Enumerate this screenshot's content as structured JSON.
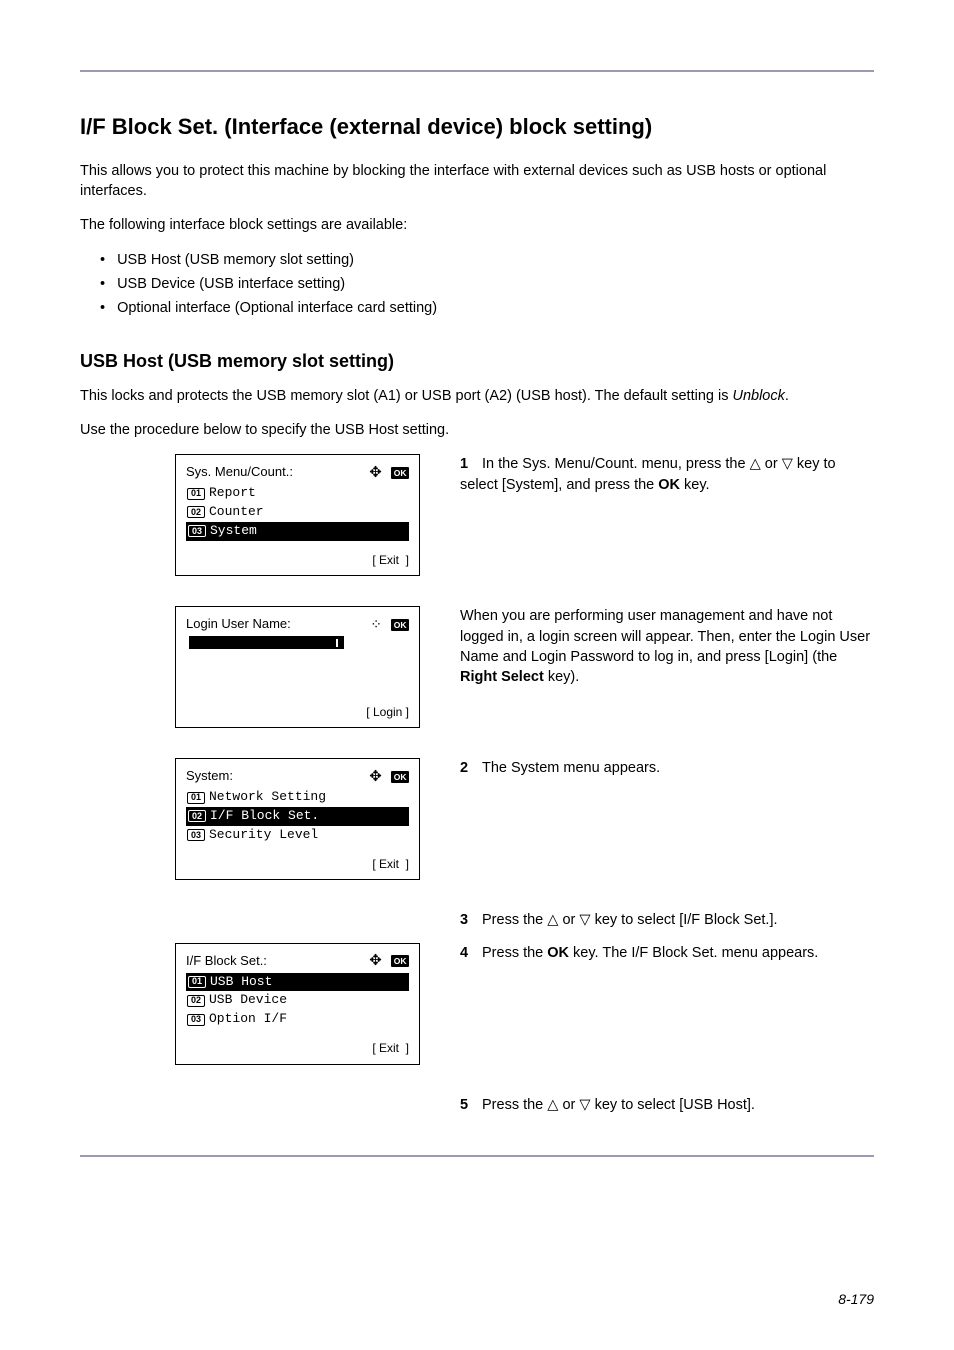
{
  "section_title": "I/F Block Set. (Interface (external device) block setting)",
  "intro": "This allows you to protect this machine by blocking the interface with external devices such as USB hosts or optional interfaces.",
  "intro2": "The following interface block settings are available:",
  "bullets": [
    "USB Host (USB memory slot setting)",
    "USB Device (USB interface setting)",
    "Optional interface (Optional interface card setting)"
  ],
  "sub_title": "USB Host (USB memory slot setting)",
  "sub_intro_a": "This locks and protects the USB memory slot (A1) or USB port (A2) (USB host). The default setting is ",
  "sub_intro_b": "Unblock",
  "sub_intro_c": ".",
  "sub_intro2": "Use the procedure below to specify the USB Host setting.",
  "steps": {
    "s1": {
      "num": "1",
      "text_a": "In the Sys. Menu/Count. menu, press the ",
      "text_b": " or ",
      "text_c": " key to select [System], and press the ",
      "text_d": "OK",
      "text_e": " key."
    },
    "s2": {
      "text_a": "When you are performing user management and have not logged in, a login screen will appear. Then, enter the Login User Name and Login Password to log in, and press [Login] (the ",
      "text_b": "Right Select",
      "text_c": " key)."
    },
    "s3": {
      "num": "2",
      "text": "The System menu appears."
    },
    "s4": {
      "num": "3",
      "text_a": "Press the ",
      "text_b": " or ",
      "text_c": " key to select [I/F Block Set.]."
    },
    "s5": {
      "num": "4",
      "text_a": "Press the ",
      "text_b": "OK",
      "text_c": " key. The I/F Block Set. menu appears."
    },
    "s6": {
      "num": "5",
      "text_a": "Press the ",
      "text_b": " or ",
      "text_c": " key to select [USB Host]."
    }
  },
  "lcd1": {
    "title": "Sys. Menu/Count.:",
    "ok": "OK",
    "l1": {
      "n": "01",
      "t": "Report"
    },
    "l2": {
      "n": "02",
      "t": "Counter"
    },
    "l3": {
      "n": "03",
      "t": "System"
    },
    "soft": "[ Exit  ]"
  },
  "lcd2": {
    "title": "Login User Name:",
    "ok": "OK",
    "soft_l": "",
    "soft_r": "[ Login ]"
  },
  "lcd3": {
    "title": "System:",
    "ok": "OK",
    "l1": {
      "n": "01",
      "t": "Network Setting"
    },
    "l2": {
      "n": "02",
      "t": "I/F Block Set."
    },
    "l3": {
      "n": "03",
      "t": "Security Level"
    },
    "soft": "[ Exit  ]"
  },
  "lcd4": {
    "title": "I/F Block Set.:",
    "ok": "OK",
    "l1": {
      "n": "01",
      "t": "USB Host"
    },
    "l2": {
      "n": "02",
      "t": "USB Device"
    },
    "l3": {
      "n": "03",
      "t": "Option I/F"
    },
    "soft": "[ Exit  ]"
  },
  "footer": "8-179"
}
